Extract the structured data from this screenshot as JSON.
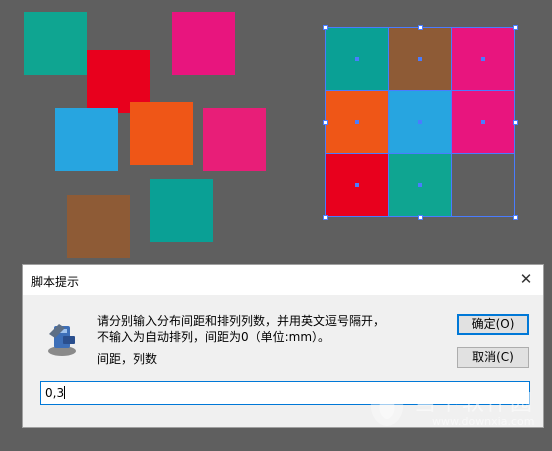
{
  "colors": {
    "teal": "#0fa591",
    "red": "#e8001d",
    "magenta": "#e8157e",
    "blue": "#27a5e0",
    "orange": "#ef5617",
    "brown": "#8e5b36",
    "teal2": "#0aa095",
    "pink": "#e81e78",
    "selection": "#4a7cff"
  },
  "dialog": {
    "title": "脚本提示",
    "close_icon": "close-icon",
    "message_line1": "请分别输入分布间距和排列列数，并用英文逗号隔开，",
    "message_line2": "不输入为自动排列，间距为0（单位:mm）。",
    "prompt_label": "间距，列数",
    "ok_label": "确定(O)",
    "cancel_label": "取消(C)",
    "input_value": "0,3"
  },
  "watermark": {
    "text": "当下软件园",
    "url": "www.downxia.com"
  }
}
